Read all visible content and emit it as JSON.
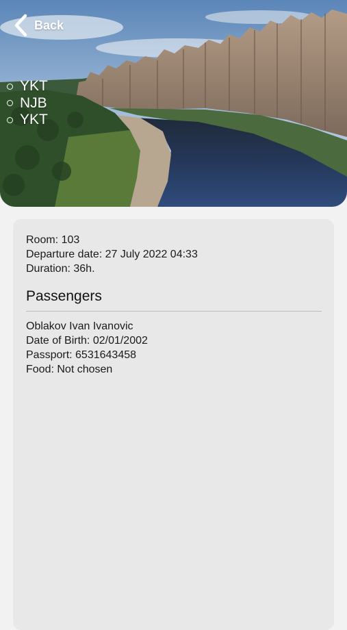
{
  "header": {
    "back_label": "Back",
    "route": [
      "YKT",
      "NJB",
      "YKT"
    ]
  },
  "trip": {
    "room": "Room: 103",
    "departure": "Departure date: 27 July 2022 04:33",
    "duration": "Duration: 36h."
  },
  "passengers": {
    "title": "Passengers",
    "items": [
      {
        "name": "Oblakov Ivan Ivanovic",
        "dob": "Date of Birth: 02/01/2002",
        "passport": "Passport: 6531643458",
        "food": "Food: Not chosen"
      }
    ]
  },
  "icons": {
    "back": "chevron-left-icon",
    "route_marker": "circle-outline-icon"
  },
  "colors": {
    "card_background": "#e8e8e8",
    "page_background": "#f2f2f2",
    "header_text": "#ffffff"
  }
}
